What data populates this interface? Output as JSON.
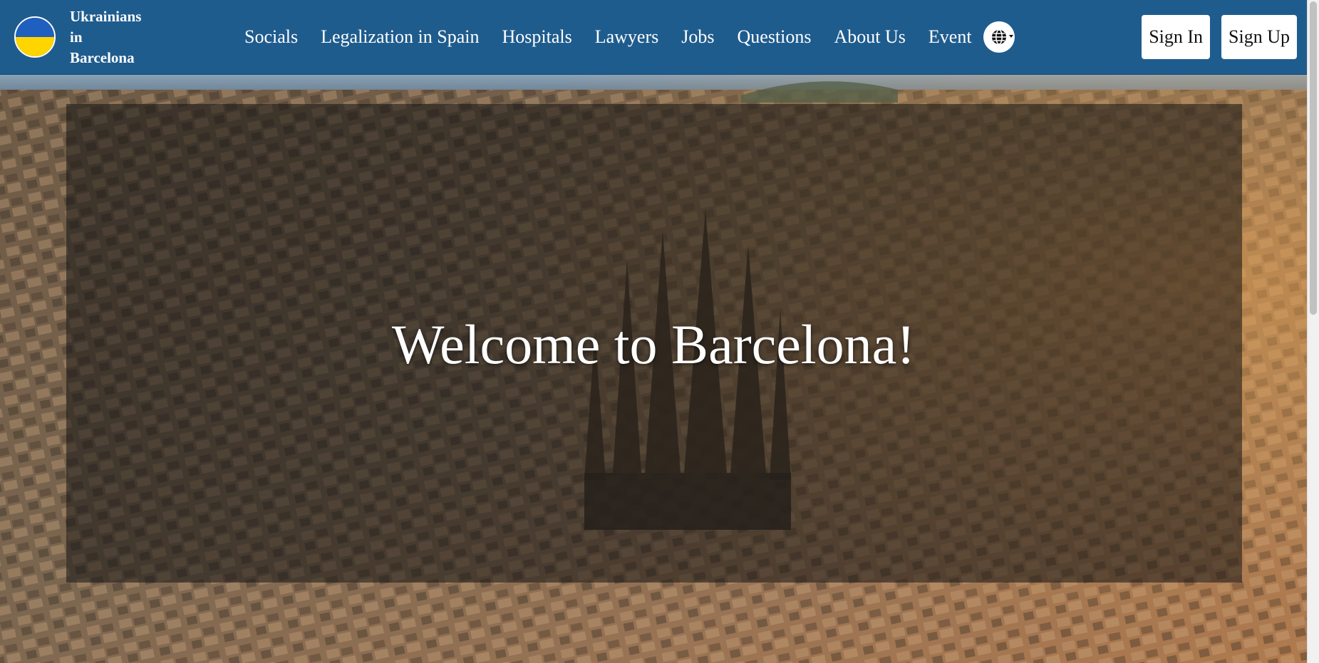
{
  "brand": {
    "name_line1": "Ukrainians",
    "name_line2": "in",
    "name_line3": "Barcelona",
    "logo_icon": "ukraine-flag-icon",
    "flag_colors": [
      "#1f5fbf",
      "#ffd500"
    ]
  },
  "nav": {
    "items": [
      {
        "label": "Socials"
      },
      {
        "label": "Legalization in Spain"
      },
      {
        "label": "Hospitals"
      },
      {
        "label": "Lawyers"
      },
      {
        "label": "Jobs"
      },
      {
        "label": "Questions"
      },
      {
        "label": "About Us"
      },
      {
        "label": "Event"
      }
    ],
    "language_icon": "globe-icon"
  },
  "auth": {
    "sign_in_label": "Sign In",
    "sign_up_label": "Sign Up"
  },
  "hero": {
    "title": "Welcome to Barcelona!",
    "background": "barcelona-aerial-photo"
  },
  "colors": {
    "navbar_bg": "#1f5c8e",
    "button_bg": "#ffffff",
    "text_light": "#ffffff"
  }
}
